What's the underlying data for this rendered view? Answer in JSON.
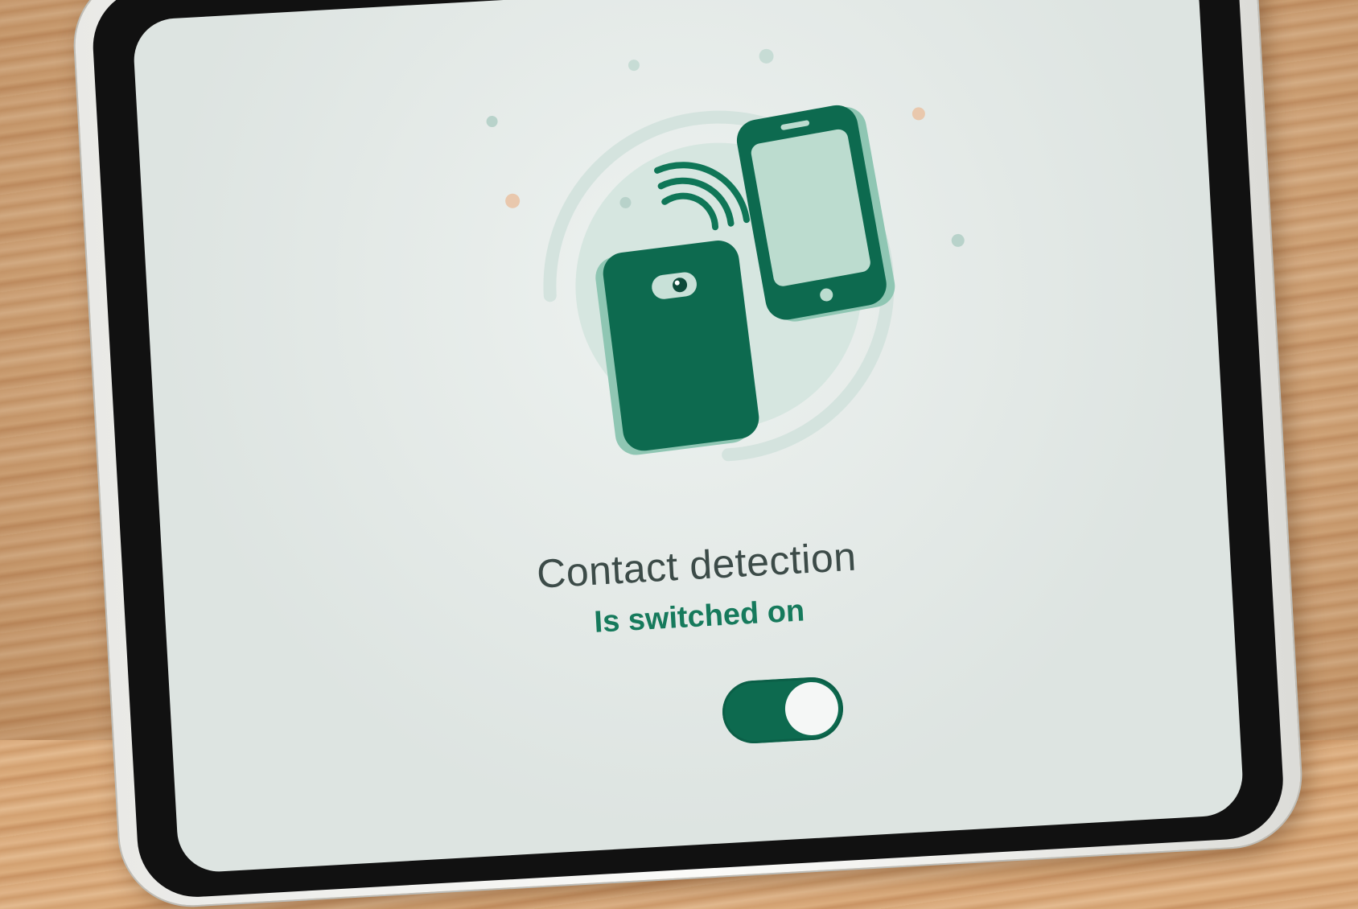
{
  "screen": {
    "title": "Contact detection",
    "subtitle": "Is switched on"
  },
  "toggle": {
    "state": "on"
  },
  "colors": {
    "accent": "#0d6a4f",
    "accent_light": "#167a5c",
    "screen_bg": "#e4ebe8",
    "text": "#3c4b48"
  },
  "icons": [
    "phone-back-icon",
    "phone-front-icon",
    "wireless-signal-icon"
  ]
}
